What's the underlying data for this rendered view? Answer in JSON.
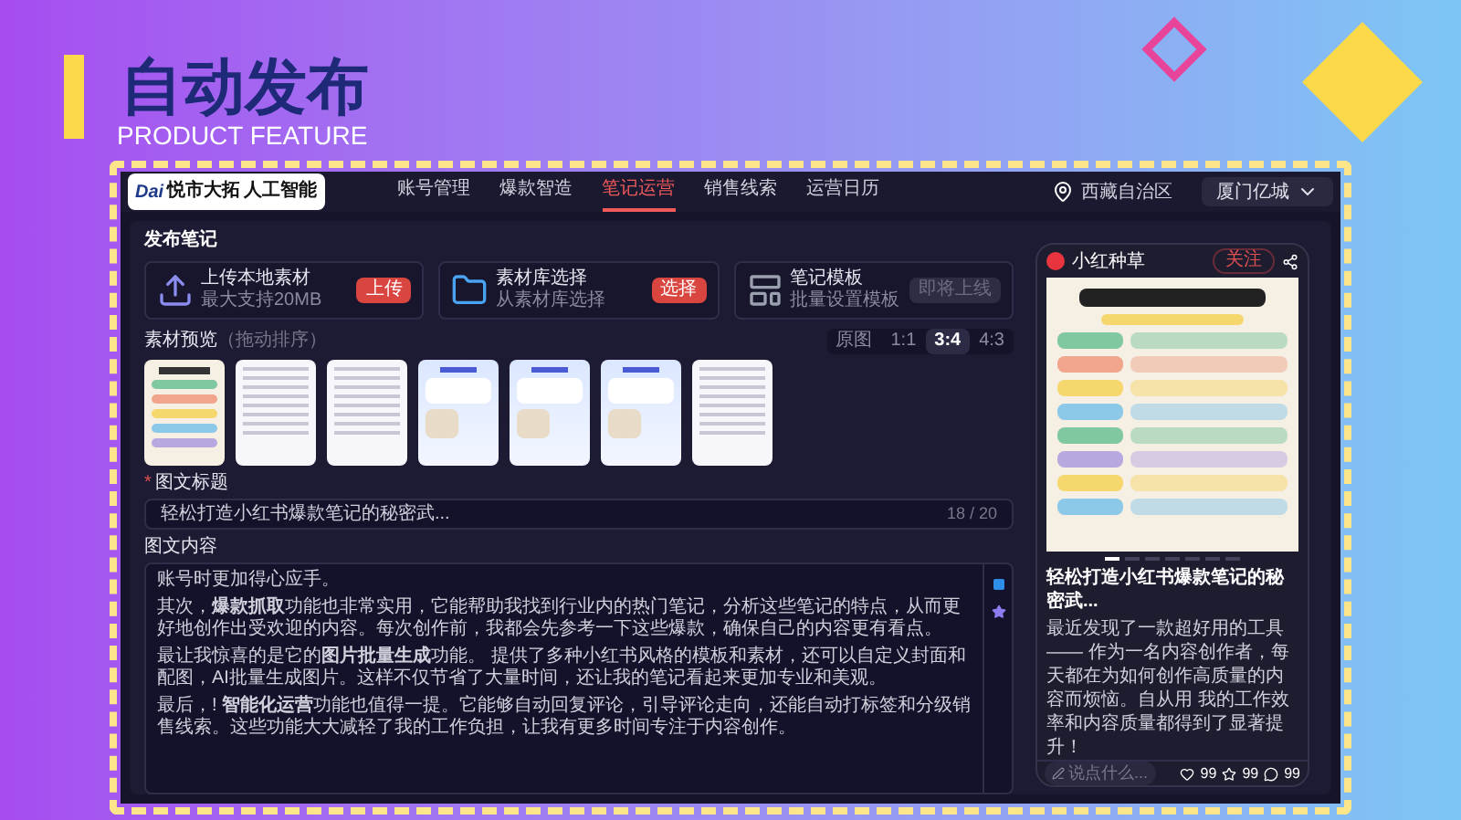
{
  "header": {
    "title": "自动发布",
    "subtitle": "PRODUCT FEATURE"
  },
  "logo": {
    "mark": "Dai",
    "line_1": "悦市大拓",
    "line_2": "人工智能"
  },
  "nav": [
    {
      "label": "账号管理",
      "selected": false
    },
    {
      "label": "爆款智造",
      "selected": false
    },
    {
      "label": "笔记运营",
      "selected": true
    },
    {
      "label": "销售线索",
      "selected": false
    },
    {
      "label": "运营日历",
      "selected": false
    }
  ],
  "location": "西藏自治区",
  "account": "厦门亿城",
  "panel_title": "发布笔记",
  "sources": [
    {
      "kind": "upload",
      "title": "上传本地素材",
      "hint": "最大支持20MB",
      "button": "上传",
      "disabled": false
    },
    {
      "kind": "library",
      "title": "素材库选择",
      "hint": "从素材库选择",
      "button": "选择",
      "disabled": false
    },
    {
      "kind": "template",
      "title": "笔记模板",
      "hint": "批量设置模板",
      "button": "即将上线",
      "disabled": true
    }
  ],
  "preview": {
    "label": "素材预览",
    "hint": "（拖动排序）",
    "ratios": [
      {
        "label": "原图",
        "selected": false
      },
      {
        "label": "1:1",
        "selected": false
      },
      {
        "label": "3:4",
        "selected": true
      },
      {
        "label": "4:3",
        "selected": false
      }
    ],
    "thumbnails": [
      {
        "kind": "poster"
      },
      {
        "kind": "doc"
      },
      {
        "kind": "doc"
      },
      {
        "kind": "chat"
      },
      {
        "kind": "chat"
      },
      {
        "kind": "chat"
      },
      {
        "kind": "doc"
      }
    ]
  },
  "title_field": {
    "required_mark": "*",
    "label": "图文标题",
    "value": "轻松打造小红书爆款笔记的秘密武...",
    "counter": "18 / 20"
  },
  "content_field": {
    "label": "图文内容",
    "paragraphs": [
      "账号时更加得心应手。",
      "其次，**爆款抓取**功能也非常实用，它能帮助我找到行业内的热门笔记，分析这些笔记的特点，从而更好地创作出受欢迎的内容。每次创作前，我都会先参考一下这些爆款，确保自己的内容更有看点。",
      "最让我惊喜的是它的**图片批量生成**功能。 提供了多种小红书风格的模板和素材，还可以自定义封面和配图，AI批量生成图片。这样不仅节省了大量时间，还让我的笔记看起来更加专业和美观。",
      "最后，! **智能化运营**功能也值得一提。它能够自动回复评论，引导评论走向，还能自动打标签和分级销售线索。这些功能大大减轻了我的工作负担，让我有更多时间专注于内容创作。"
    ]
  },
  "phone": {
    "account": "小红种草",
    "follow": "关注",
    "carousel": [
      {
        "selected": true
      },
      {
        "selected": false
      },
      {
        "selected": false
      },
      {
        "selected": false
      },
      {
        "selected": false
      },
      {
        "selected": false
      },
      {
        "selected": false
      }
    ],
    "note_title": "轻松打造小红书爆款笔记的秘密武...",
    "note_body": "最近发现了一款超好用的工具—— 作为一名内容创作者，每天都在为如何创作高质量的内容而烦恼。自从用 我的工作效率和内容质量都得到了显著提升！",
    "comment_placeholder": "说点什么...",
    "likes": "99",
    "favorites": "99",
    "comments": "99"
  }
}
